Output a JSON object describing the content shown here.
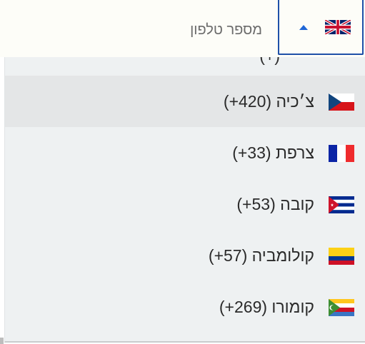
{
  "phone_field": {
    "label": "מספר טלפון"
  },
  "country_selector": {
    "selected_flag": "united-kingdom-flag-icon",
    "caret": "caret-up-icon"
  },
  "dropdown": {
    "partial_item_text": "(+)",
    "options": [
      {
        "label": "צ׳כיה (420+)",
        "flag": "czech-republic-flag-icon",
        "highlighted": true
      },
      {
        "label": "צרפת (33+)",
        "flag": "france-flag-icon",
        "highlighted": false
      },
      {
        "label": "קובה (53+)",
        "flag": "cuba-flag-icon",
        "highlighted": false
      },
      {
        "label": "קולומביה (57+)",
        "flag": "colombia-flag-icon",
        "highlighted": false
      },
      {
        "label": "קומורו (269+)",
        "flag": "comoros-flag-icon",
        "highlighted": false
      }
    ]
  },
  "colors": {
    "accent_border": "#1e50a8",
    "caret": "#1f66d6",
    "dropdown_bg": "#eef1f2",
    "highlight_bg": "#e4e6e7",
    "label_text": "#6b6b6b"
  }
}
